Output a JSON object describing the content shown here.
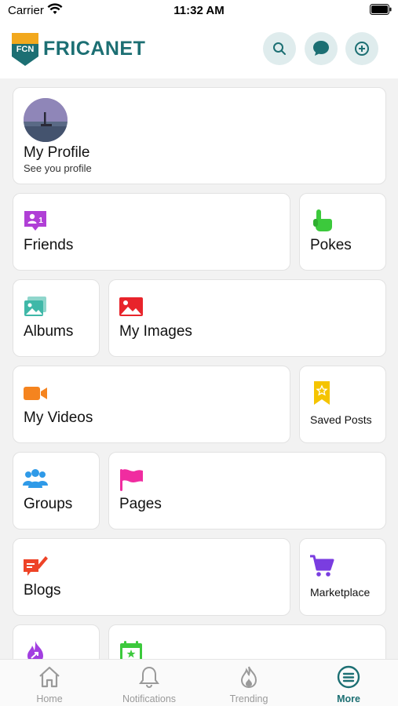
{
  "status_bar": {
    "carrier": "Carrier",
    "time": "11:32 AM"
  },
  "header": {
    "brand": "FRICANET",
    "badge_text": "FCN"
  },
  "profile": {
    "name": "My Profile",
    "subtitle": "See you profile"
  },
  "menu": {
    "friends": {
      "label": "Friends",
      "icon": "friend-request-icon",
      "color": "#b03fd6"
    },
    "pokes": {
      "label": "Pokes",
      "icon": "poke-hand-icon",
      "color": "#3cc93c"
    },
    "albums": {
      "label": "Albums",
      "icon": "albums-icon",
      "color": "#3fb8a8"
    },
    "my_images": {
      "label": "My Images",
      "icon": "image-icon",
      "color": "#e8242b"
    },
    "my_videos": {
      "label": "My Videos",
      "icon": "video-camera-icon",
      "color": "#f5841f"
    },
    "saved_posts": {
      "label": "Saved Posts",
      "icon": "bookmark-star-icon",
      "color": "#f5c400"
    },
    "groups": {
      "label": "Groups",
      "icon": "groups-icon",
      "color": "#2f9ae8"
    },
    "pages": {
      "label": "Pages",
      "icon": "flag-icon",
      "color": "#f02ca0"
    },
    "blogs": {
      "label": "Blogs",
      "icon": "blog-edit-icon",
      "color": "#ee4327"
    },
    "marketplace": {
      "label": "Marketplace",
      "icon": "cart-icon",
      "color": "#7a3de0"
    },
    "partial_left": {
      "icon": "fire-arrow-icon",
      "color": "#a23fe0"
    },
    "partial_right": {
      "icon": "calendar-star-icon",
      "color": "#3cc93c"
    }
  },
  "tabs": [
    {
      "label": "Home",
      "icon": "home-icon"
    },
    {
      "label": "Notifications",
      "icon": "bell-icon"
    },
    {
      "label": "Trending",
      "icon": "flame-icon"
    },
    {
      "label": "More",
      "icon": "menu-icon",
      "active": true
    }
  ],
  "colors": {
    "accent": "#1c6f73",
    "header_button_bg": "#dfeced",
    "inactive_tab": "#9a9a9a"
  }
}
